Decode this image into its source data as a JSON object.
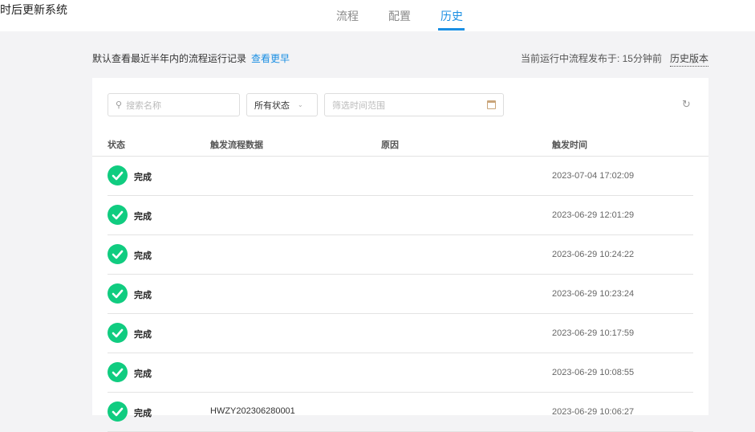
{
  "app_title": "时后更新系统",
  "tabs": [
    {
      "label": "流程"
    },
    {
      "label": "配置"
    },
    {
      "label": "历史"
    }
  ],
  "info": {
    "text": "默认查看最近半年内的流程运行记录",
    "link": "查看更早",
    "published": "当前运行中流程发布于: 15分钟前",
    "history_versions": "历史版本"
  },
  "filters": {
    "search_placeholder": "搜索名称",
    "status": "所有状态",
    "time_placeholder": "筛选时间范围"
  },
  "columns": [
    "状态",
    "触发流程数据",
    "原因",
    "触发时间"
  ],
  "rows": [
    {
      "status": "完成",
      "data": "",
      "reason": "",
      "time": "2023-07-04 17:02:09"
    },
    {
      "status": "完成",
      "data": "",
      "reason": "",
      "time": "2023-06-29 12:01:29"
    },
    {
      "status": "完成",
      "data": "",
      "reason": "",
      "time": "2023-06-29 10:24:22"
    },
    {
      "status": "完成",
      "data": "",
      "reason": "",
      "time": "2023-06-29 10:23:24"
    },
    {
      "status": "完成",
      "data": "",
      "reason": "",
      "time": "2023-06-29 10:17:59"
    },
    {
      "status": "完成",
      "data": "",
      "reason": "",
      "time": "2023-06-29 10:08:55"
    },
    {
      "status": "完成",
      "data": "HWZY202306280001",
      "reason": "",
      "time": "2023-06-29 10:06:27"
    }
  ]
}
